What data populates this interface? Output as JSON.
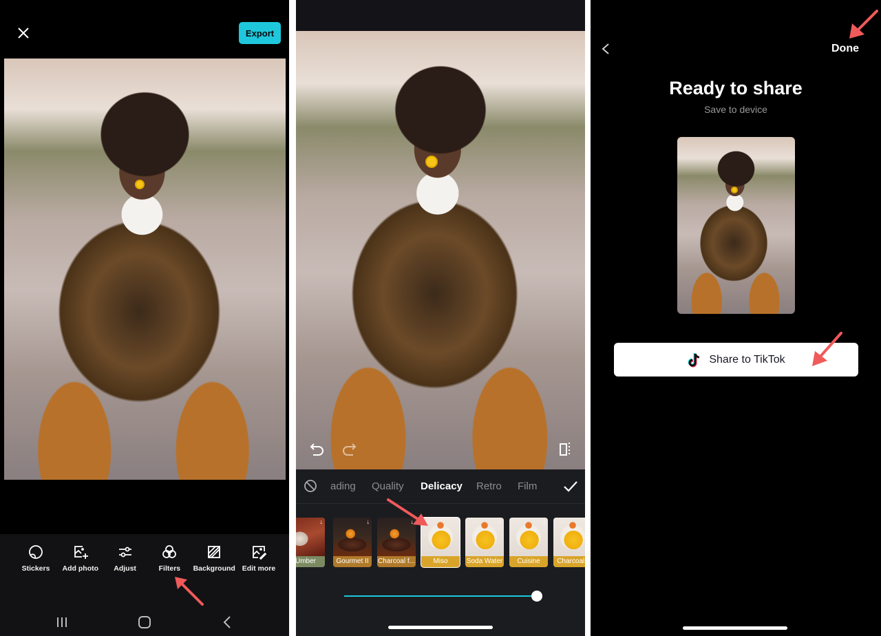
{
  "colors": {
    "accent": "#1fc7dc",
    "annotation_arrow": "#f05a5a",
    "filter_label_gold": "#d9a42a",
    "filter_label_brown": "#b07a2a",
    "filter_label_green": "#7c8a62"
  },
  "panel1": {
    "close_icon": "close-icon",
    "export_label": "Export",
    "toolbar": [
      {
        "icon": "sticker-icon",
        "label": "Stickers"
      },
      {
        "icon": "add-photo-icon",
        "label": "Add photo"
      },
      {
        "icon": "adjust-icon",
        "label": "Adjust"
      },
      {
        "icon": "filters-icon",
        "label": "Filters"
      },
      {
        "icon": "background-icon",
        "label": "Background"
      },
      {
        "icon": "edit-more-icon",
        "label": "Edit more"
      }
    ],
    "nav": [
      "recent-apps-icon",
      "home-icon",
      "back-icon"
    ]
  },
  "panel2": {
    "canvas_controls": [
      "undo-icon",
      "redo-icon",
      "compare-icon"
    ],
    "filter_tabs": [
      {
        "label": "ading",
        "active": false
      },
      {
        "label": "Quality",
        "active": false
      },
      {
        "label": "Delicacy",
        "active": true
      },
      {
        "label": "Retro",
        "active": false
      },
      {
        "label": "Film",
        "active": false
      }
    ],
    "filters": [
      {
        "label": "Umber",
        "downloadable": true,
        "selected": false
      },
      {
        "label": "Gourmet II",
        "downloadable": true,
        "selected": false
      },
      {
        "label": "Charcoal f...",
        "downloadable": true,
        "selected": false
      },
      {
        "label": "Miso",
        "downloadable": false,
        "selected": true
      },
      {
        "label": "Soda Water",
        "downloadable": true,
        "selected": false
      },
      {
        "label": "Cuisine",
        "downloadable": true,
        "selected": false
      },
      {
        "label": "Charcoal f",
        "downloadable": false,
        "selected": false
      }
    ],
    "intensity_percent": 100
  },
  "panel3": {
    "done_label": "Done",
    "title": "Ready to share",
    "subtitle": "Save to device",
    "share_label": "Share to TikTok"
  }
}
